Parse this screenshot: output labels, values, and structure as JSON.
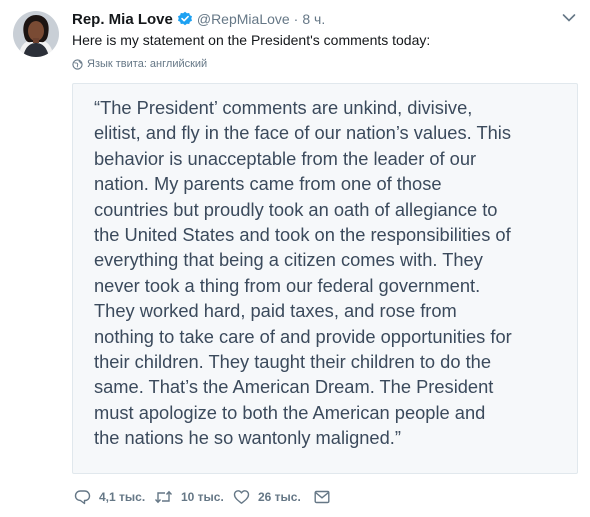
{
  "tweet": {
    "display_name": "Rep. Mia Love",
    "handle": "@RepMiaLove",
    "separator": "·",
    "time": "8 ч.",
    "text": "Here is my statement on the President's comments today:",
    "language_label": "Язык твита: английский"
  },
  "statement_lines": [
    "“The President’ comments are unkind, divisive,",
    "elitist, and fly in the face of our nation’s values. This",
    "behavior is unacceptable from the leader of our",
    "nation. My parents came from one of those",
    "countries but proudly took an oath of allegiance to",
    "the United States and took on the responsibilities of",
    "everything that being a citizen comes with. They",
    "never took a thing from our federal government.",
    "They worked hard, paid taxes, and rose from",
    "nothing to take care of and provide opportunities for",
    "their children. They taught their children to do the",
    "same. That’s the American Dream. The President",
    "must apologize to both the American people and",
    "the nations he so wantonly maligned.”"
  ],
  "actions": {
    "replies": "4,1 тыс.",
    "retweets": "10 тыс.",
    "likes": "26 тыс."
  },
  "icons": {
    "verified": "verified-badge-icon",
    "caret": "chevron-down-icon",
    "globe": "globe-icon",
    "reply": "reply-icon",
    "retweet": "retweet-icon",
    "like": "heart-icon",
    "message": "envelope-icon"
  },
  "colors": {
    "verified": "#1da1f2",
    "secondary_text": "#657786",
    "card_background": "#f6f8fa",
    "statement_text": "#3b4a5c"
  }
}
